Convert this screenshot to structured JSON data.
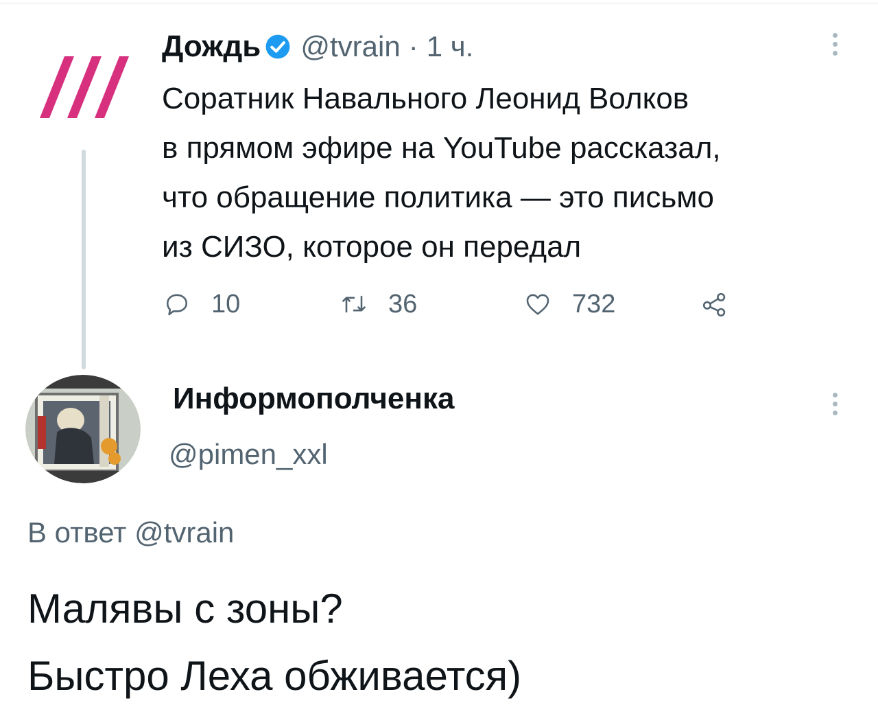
{
  "tweet": {
    "author_name": "Дождь",
    "author_handle": "@tvrain",
    "time_sep": "·",
    "time": "1 ч.",
    "text": "Соратник Навального Леонид Волков\nв прямом эфире на YouTube рассказал,\nчто обращение политика — это письмо\nиз СИЗО, которое он передал",
    "actions": {
      "replies": "10",
      "retweets": "36",
      "likes": "732"
    }
  },
  "reply": {
    "author_name": "Информополченка",
    "author_handle": "@pimen_xxl",
    "reply_to_label": "В ответ",
    "reply_to_handle": "@tvrain",
    "text": "Малявы с зоны?\nБыстро Леха обживается)"
  },
  "icons": {
    "logo": "tvrain-logo-icon",
    "verified": "verified-badge-icon",
    "more": "more-options-icon",
    "reply": "reply-icon",
    "retweet": "retweet-icon",
    "like": "heart-icon",
    "share": "share-icon"
  },
  "colors": {
    "logo": "#d6307e",
    "verified": "#1d9bf0",
    "text": "#0f1419",
    "secondary": "#536471",
    "thread_line": "#cfd9de"
  }
}
